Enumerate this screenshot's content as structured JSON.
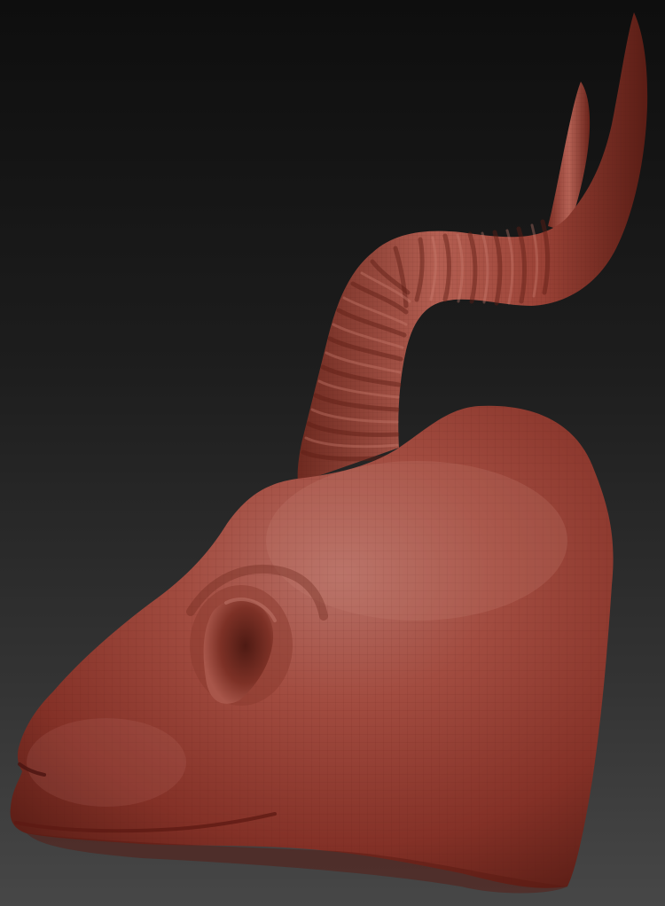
{
  "viewport": {
    "background_top": "#0e0e0e",
    "background_bottom": "#474747"
  },
  "model": {
    "subject": "antelope-head-sculpt",
    "material_color": "#a8473c",
    "material_highlight": "#c06a5e",
    "material_shadow": "#4a1712",
    "wireframe_visible": true
  }
}
